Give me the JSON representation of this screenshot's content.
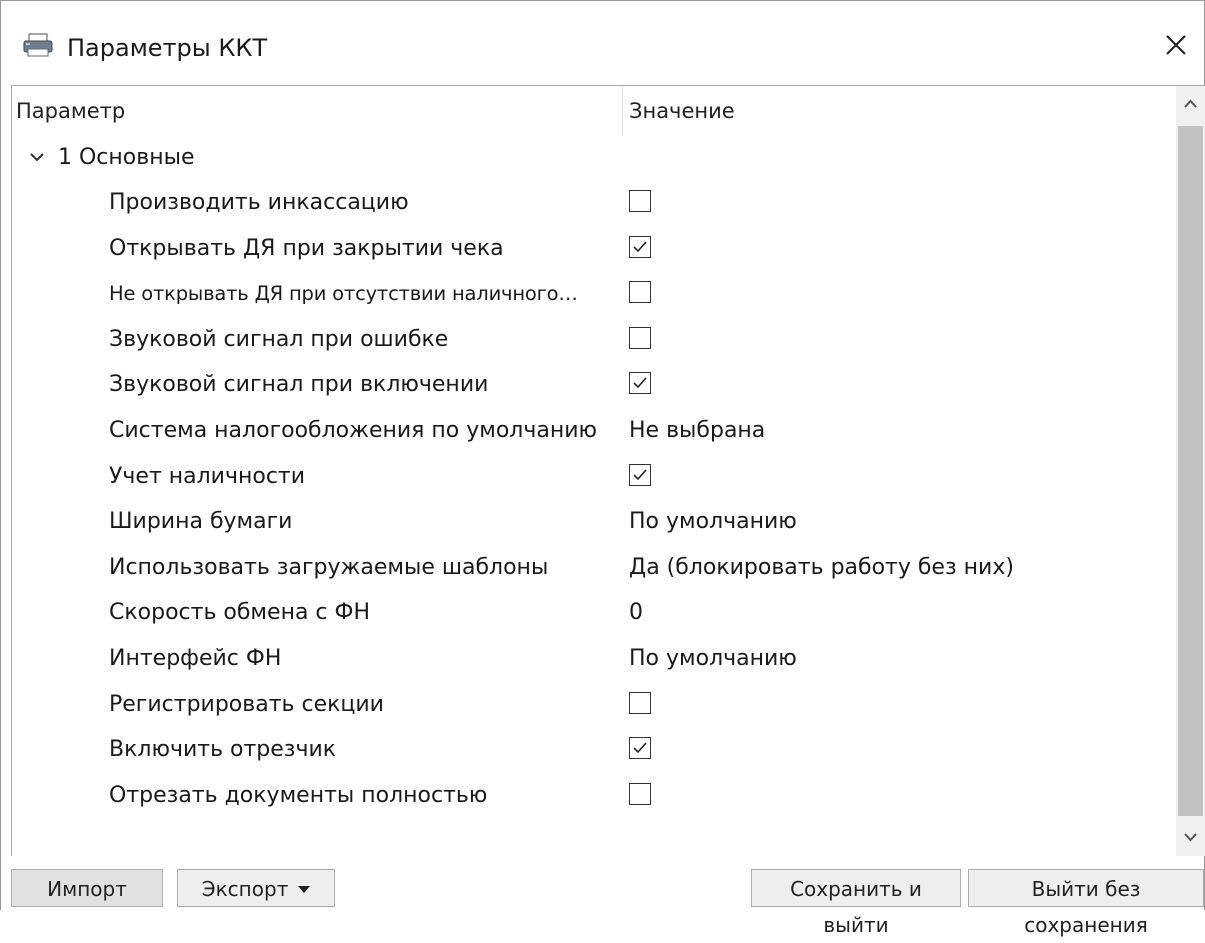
{
  "window": {
    "title": "Параметры ККТ",
    "icon": "printer-icon",
    "close_glyph": "✕"
  },
  "columns": {
    "param": "Параметр",
    "value": "Значение"
  },
  "group": {
    "label": "1 Основные",
    "expanded": true
  },
  "rows": [
    {
      "name": "Производить инкассацию",
      "type": "checkbox",
      "checked": false
    },
    {
      "name": "Открывать ДЯ при закрытии чека",
      "type": "checkbox",
      "checked": true
    },
    {
      "name": "Не открывать ДЯ при отсутствии наличного…",
      "type": "checkbox",
      "checked": false
    },
    {
      "name": "Звуковой сигнал при ошибке",
      "type": "checkbox",
      "checked": false
    },
    {
      "name": "Звуковой сигнал при включении",
      "type": "checkbox",
      "checked": true
    },
    {
      "name": "Система налогообложения по умолчанию",
      "type": "text",
      "value": "Не выбрана"
    },
    {
      "name": "Учет наличности",
      "type": "checkbox",
      "checked": true
    },
    {
      "name": "Ширина бумаги",
      "type": "text",
      "value": "По умолчанию"
    },
    {
      "name": "Использовать загружаемые шаблоны",
      "type": "text",
      "value": "Да (блокировать работу без них)"
    },
    {
      "name": "Скорость обмена с ФН",
      "type": "text",
      "value": "0"
    },
    {
      "name": "Интерфейс ФН",
      "type": "text",
      "value": "По умолчанию"
    },
    {
      "name": "Регистрировать секции",
      "type": "checkbox",
      "checked": false
    },
    {
      "name": "Включить отрезчик",
      "type": "checkbox",
      "checked": true
    },
    {
      "name": "Отрезать документы полностью",
      "type": "checkbox",
      "checked": false
    }
  ],
  "footer": {
    "import_label": "Импорт",
    "export_label": "Экспорт",
    "save_exit_label": "Сохранить и выйти",
    "exit_no_save_label": "Выйти без сохранения"
  },
  "colors": {
    "scroll_thumb": "#c2c2c2",
    "scroll_track": "#f0f0f0",
    "button_bg": "#e1e1e1"
  }
}
